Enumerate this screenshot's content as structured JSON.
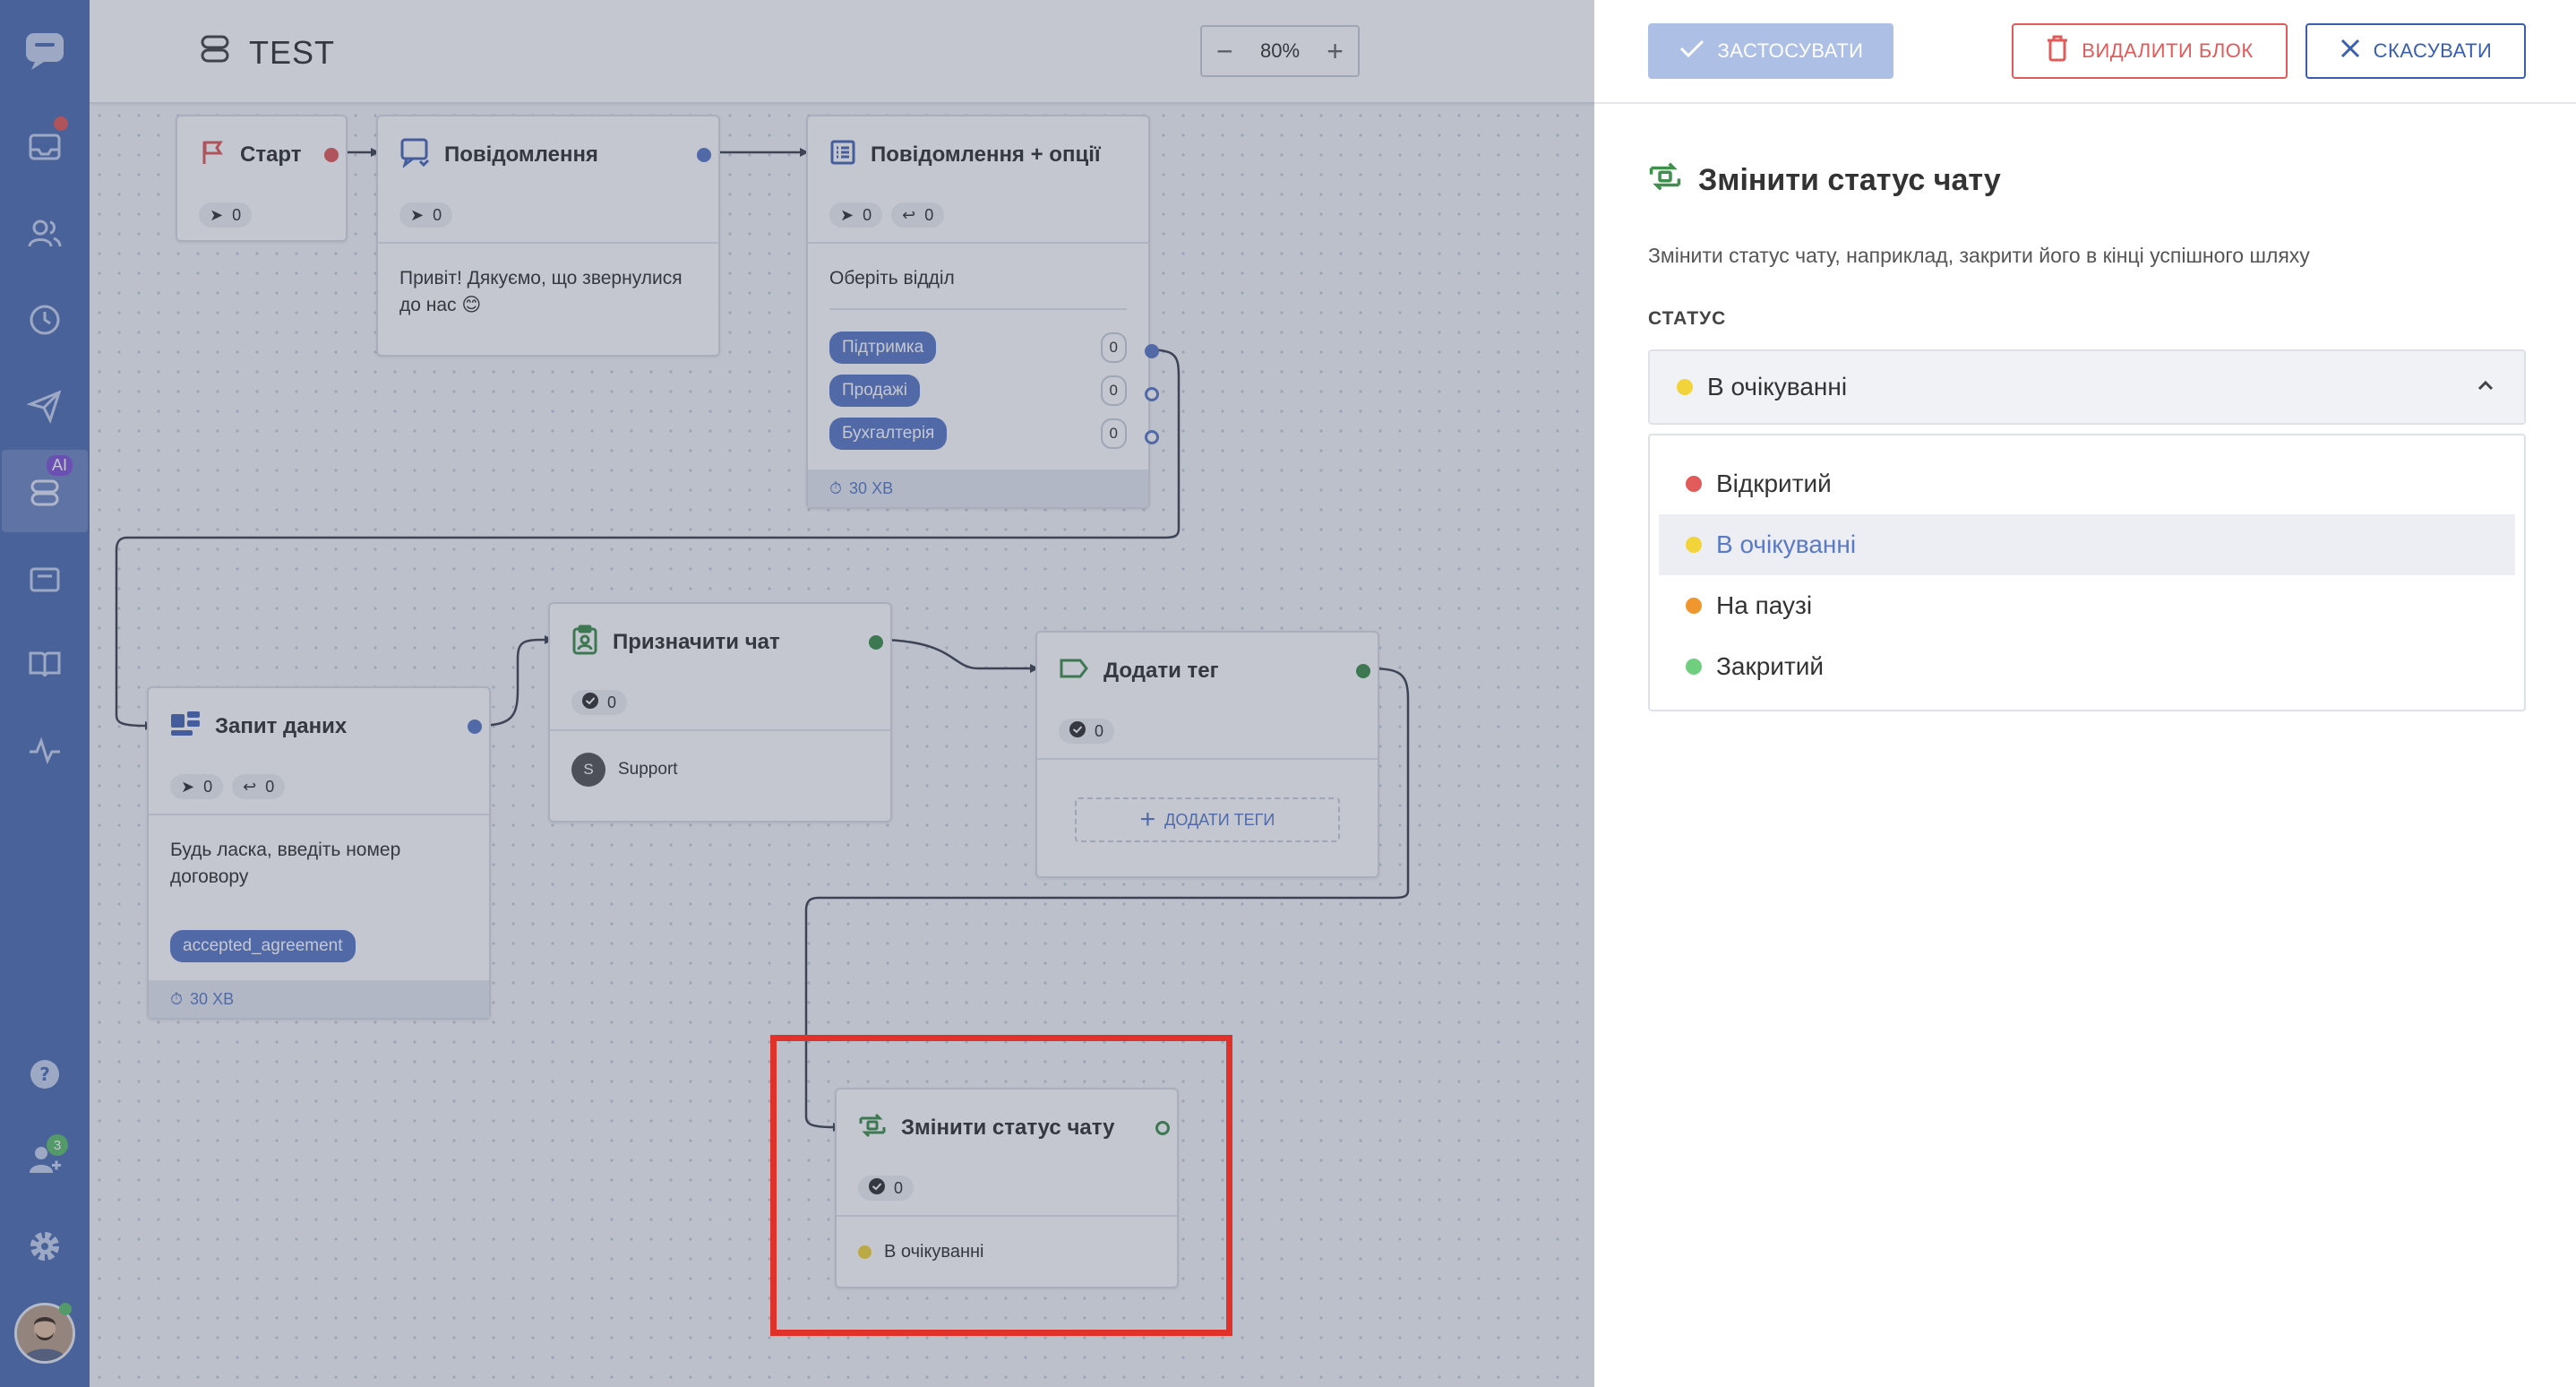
{
  "header": {
    "title": "TEST",
    "zoom": "80%"
  },
  "sidebar": {
    "badge_ai": "AI",
    "badge_count": "3"
  },
  "nodes": {
    "start": {
      "title": "Старт",
      "sent": "0"
    },
    "message": {
      "title": "Повідомлення",
      "sent": "0",
      "text": "Привіт! Дякуємо, що звернулися до нас 😊"
    },
    "options": {
      "title": "Повідомлення + опції",
      "sent": "0",
      "replied": "0",
      "text": "Оберіть відділ",
      "items": [
        {
          "label": "Підтримка",
          "count": "0"
        },
        {
          "label": "Продажі",
          "count": "0"
        },
        {
          "label": "Бухгалтерія",
          "count": "0"
        }
      ],
      "timeout": "30 ХВ"
    },
    "assign": {
      "title": "Призначити чат",
      "done": "0",
      "agent_initial": "S",
      "agent": "Support"
    },
    "tag": {
      "title": "Додати тег",
      "done": "0",
      "add_tags": "ДОДАТИ ТЕГИ"
    },
    "data": {
      "title": "Запит даних",
      "sent": "0",
      "replied": "0",
      "text": "Будь ласка, введіть номер договору",
      "variable": "accepted_agreement",
      "timeout": "30 ХВ"
    },
    "status": {
      "title": "Змінити статус чату",
      "done": "0",
      "value": "В очікуванні"
    }
  },
  "panel": {
    "apply": "ЗАСТОСУВАТИ",
    "delete": "ВИДАЛИТИ БЛОК",
    "cancel": "СКАСУВАТИ",
    "title": "Змінити статус чату",
    "description": "Змінити статус чату, наприклад, закрити його в кінці успішного шляху",
    "status_label": "СТАТУС",
    "selected": "В очікуванні",
    "options": [
      {
        "label": "Відкритий",
        "color": "#e25b5b"
      },
      {
        "label": "В очікуванні",
        "color": "#f2d43a"
      },
      {
        "label": "На паузі",
        "color": "#f0962e"
      },
      {
        "label": "Закритий",
        "color": "#6fcf7f"
      }
    ]
  }
}
